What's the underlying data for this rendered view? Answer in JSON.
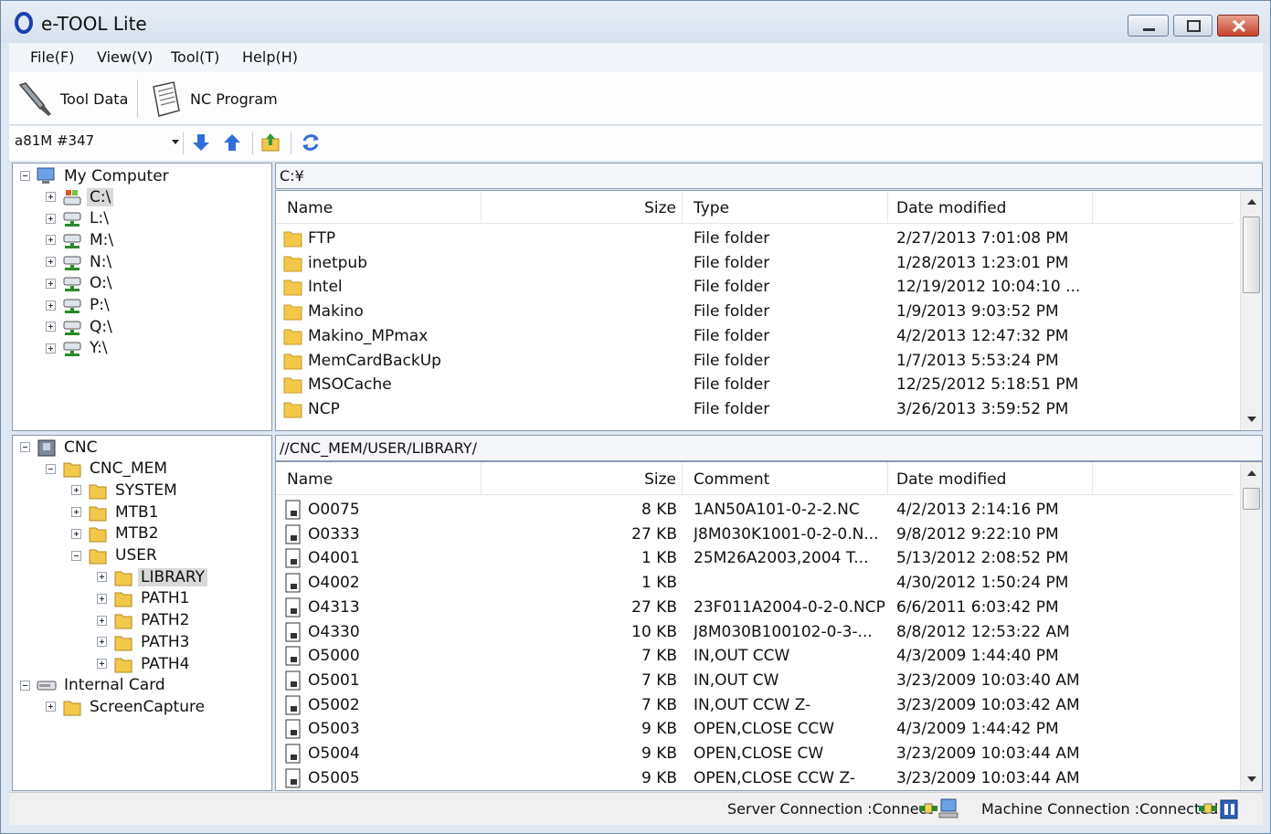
{
  "window": {
    "title": "e-TOOL Lite"
  },
  "menu": [
    "File(F)",
    "View(V)",
    "Tool(T)",
    "Help(H)"
  ],
  "toolbar": {
    "tool_data": "Tool Data",
    "nc_program": "NC Program"
  },
  "nav": {
    "machine": "a81M #347"
  },
  "pc_tree": {
    "root": "My Computer",
    "drives": [
      "C:\\",
      "L:\\",
      "M:\\",
      "N:\\",
      "O:\\",
      "P:\\",
      "Q:\\",
      "Y:\\"
    ],
    "selected": "C:\\"
  },
  "pc_path": "C:¥",
  "pc_list": {
    "columns": {
      "name": "Name",
      "size": "Size",
      "type": "Type",
      "date": "Date modified"
    },
    "rows": [
      {
        "name": "FTP",
        "size": "",
        "type": "File folder",
        "date": "2/27/2013 7:01:08 PM"
      },
      {
        "name": "inetpub",
        "size": "",
        "type": "File folder",
        "date": "1/28/2013 1:23:01 PM"
      },
      {
        "name": "Intel",
        "size": "",
        "type": "File folder",
        "date": "12/19/2012 10:04:10 ..."
      },
      {
        "name": "Makino",
        "size": "",
        "type": "File folder",
        "date": "1/9/2013 9:03:52 PM"
      },
      {
        "name": "Makino_MPmax",
        "size": "",
        "type": "File folder",
        "date": "4/2/2013 12:47:32 PM"
      },
      {
        "name": "MemCardBackUp",
        "size": "",
        "type": "File folder",
        "date": "1/7/2013 5:53:24 PM"
      },
      {
        "name": "MSOCache",
        "size": "",
        "type": "File folder",
        "date": "12/25/2012 5:18:51 PM"
      },
      {
        "name": "NCP",
        "size": "",
        "type": "File folder",
        "date": "3/26/2013 3:59:52 PM"
      }
    ]
  },
  "cnc_tree": {
    "root": "CNC",
    "mem": "CNC_MEM",
    "system": "SYSTEM",
    "mtb1": "MTB1",
    "mtb2": "MTB2",
    "user": "USER",
    "library": "LIBRARY",
    "path1": "PATH1",
    "path2": "PATH2",
    "path3": "PATH3",
    "path4": "PATH4",
    "card": "Internal Card",
    "screencapture": "ScreenCapture"
  },
  "cnc_path": "//CNC_MEM/USER/LIBRARY/",
  "cnc_list": {
    "columns": {
      "name": "Name",
      "size": "Size",
      "comment": "Comment",
      "date": "Date modified"
    },
    "rows": [
      {
        "name": "O0075",
        "size": "8 KB",
        "comment": "1AN50A101-0-2-2.NC",
        "date": "4/2/2013 2:14:16 PM"
      },
      {
        "name": "O0333",
        "size": "27 KB",
        "comment": "J8M030K1001-0-2-0.N...",
        "date": "9/8/2012 9:22:10 PM"
      },
      {
        "name": "O4001",
        "size": "1 KB",
        "comment": "25M26A2003,2004 T...",
        "date": "5/13/2012 2:08:52 PM"
      },
      {
        "name": "O4002",
        "size": "1 KB",
        "comment": "",
        "date": "4/30/2012 1:50:24 PM"
      },
      {
        "name": "O4313",
        "size": "27 KB",
        "comment": "23F011A2004-0-2-0.NCP",
        "date": "6/6/2011 6:03:42 PM"
      },
      {
        "name": "O4330",
        "size": "10 KB",
        "comment": "J8M030B100102-0-3-...",
        "date": "8/8/2012 12:53:22 AM"
      },
      {
        "name": "O5000",
        "size": "7 KB",
        "comment": "IN,OUT CCW",
        "date": "4/3/2009 1:44:40 PM"
      },
      {
        "name": "O5001",
        "size": "7 KB",
        "comment": "IN,OUT CW",
        "date": "3/23/2009 10:03:40 AM"
      },
      {
        "name": "O5002",
        "size": "7 KB",
        "comment": "IN,OUT CCW Z-",
        "date": "3/23/2009 10:03:42 AM"
      },
      {
        "name": "O5003",
        "size": "9 KB",
        "comment": "OPEN,CLOSE CCW",
        "date": "4/3/2009 1:44:42 PM"
      },
      {
        "name": "O5004",
        "size": "9 KB",
        "comment": "OPEN,CLOSE CW",
        "date": "3/23/2009 10:03:44 AM"
      },
      {
        "name": "O5005",
        "size": "9 KB",
        "comment": "OPEN,CLOSE CCW Z-",
        "date": "3/23/2009 10:03:44 AM"
      }
    ]
  },
  "status": {
    "server": "Server Connection :Connect",
    "machine": "Machine Connection :Connected"
  },
  "colors": {
    "folder": "#f2c84b",
    "accent": "#2d6fd6"
  }
}
